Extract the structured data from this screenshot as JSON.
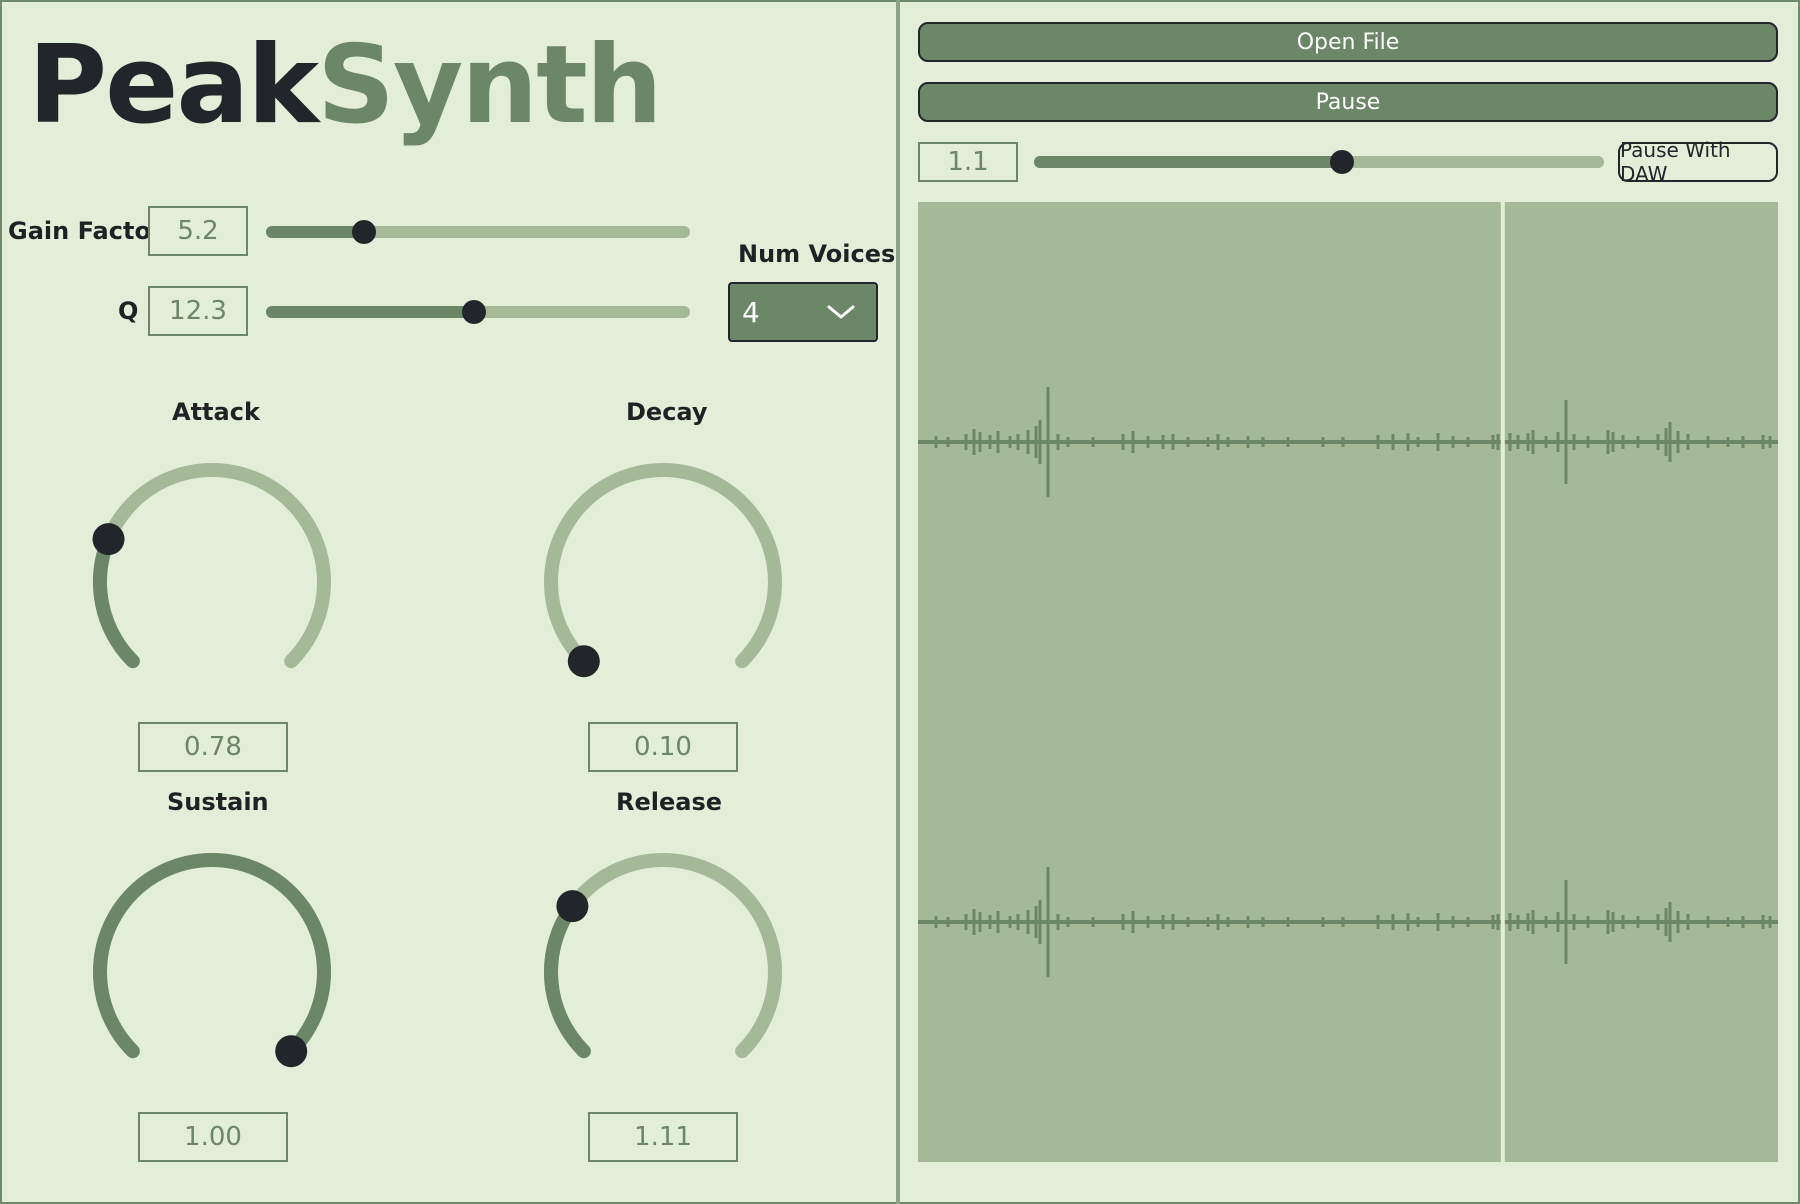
{
  "app": {
    "title_part1": "Peak",
    "title_part2": "Synth"
  },
  "controls": {
    "gain_factor": {
      "label": "Gain Factor",
      "value": "5.2",
      "level": 0.23
    },
    "q": {
      "label": "Q",
      "value": "12.3",
      "level": 0.49
    },
    "num_voices": {
      "label": "Num Voices",
      "selected": "4"
    }
  },
  "knobs": [
    {
      "label": "Attack",
      "value": "0.78",
      "level": 0.25
    },
    {
      "label": "Decay",
      "value": "0.10",
      "level": 0.0
    },
    {
      "label": "Sustain",
      "value": "1.00",
      "level": 1.0
    },
    {
      "label": "Release",
      "value": "1.11",
      "level": 0.3
    }
  ],
  "player": {
    "open_file_label": "Open File",
    "pause_label": "Pause",
    "speed_value": "1.1",
    "speed_level": 0.54,
    "pause_with_daw_label": "Pause With DAW",
    "playhead_fraction": 0.68
  },
  "colors": {
    "background": "#e2eed8",
    "accent": "#6c8767",
    "accent_light": "#a3b998",
    "dark": "#22262a"
  }
}
